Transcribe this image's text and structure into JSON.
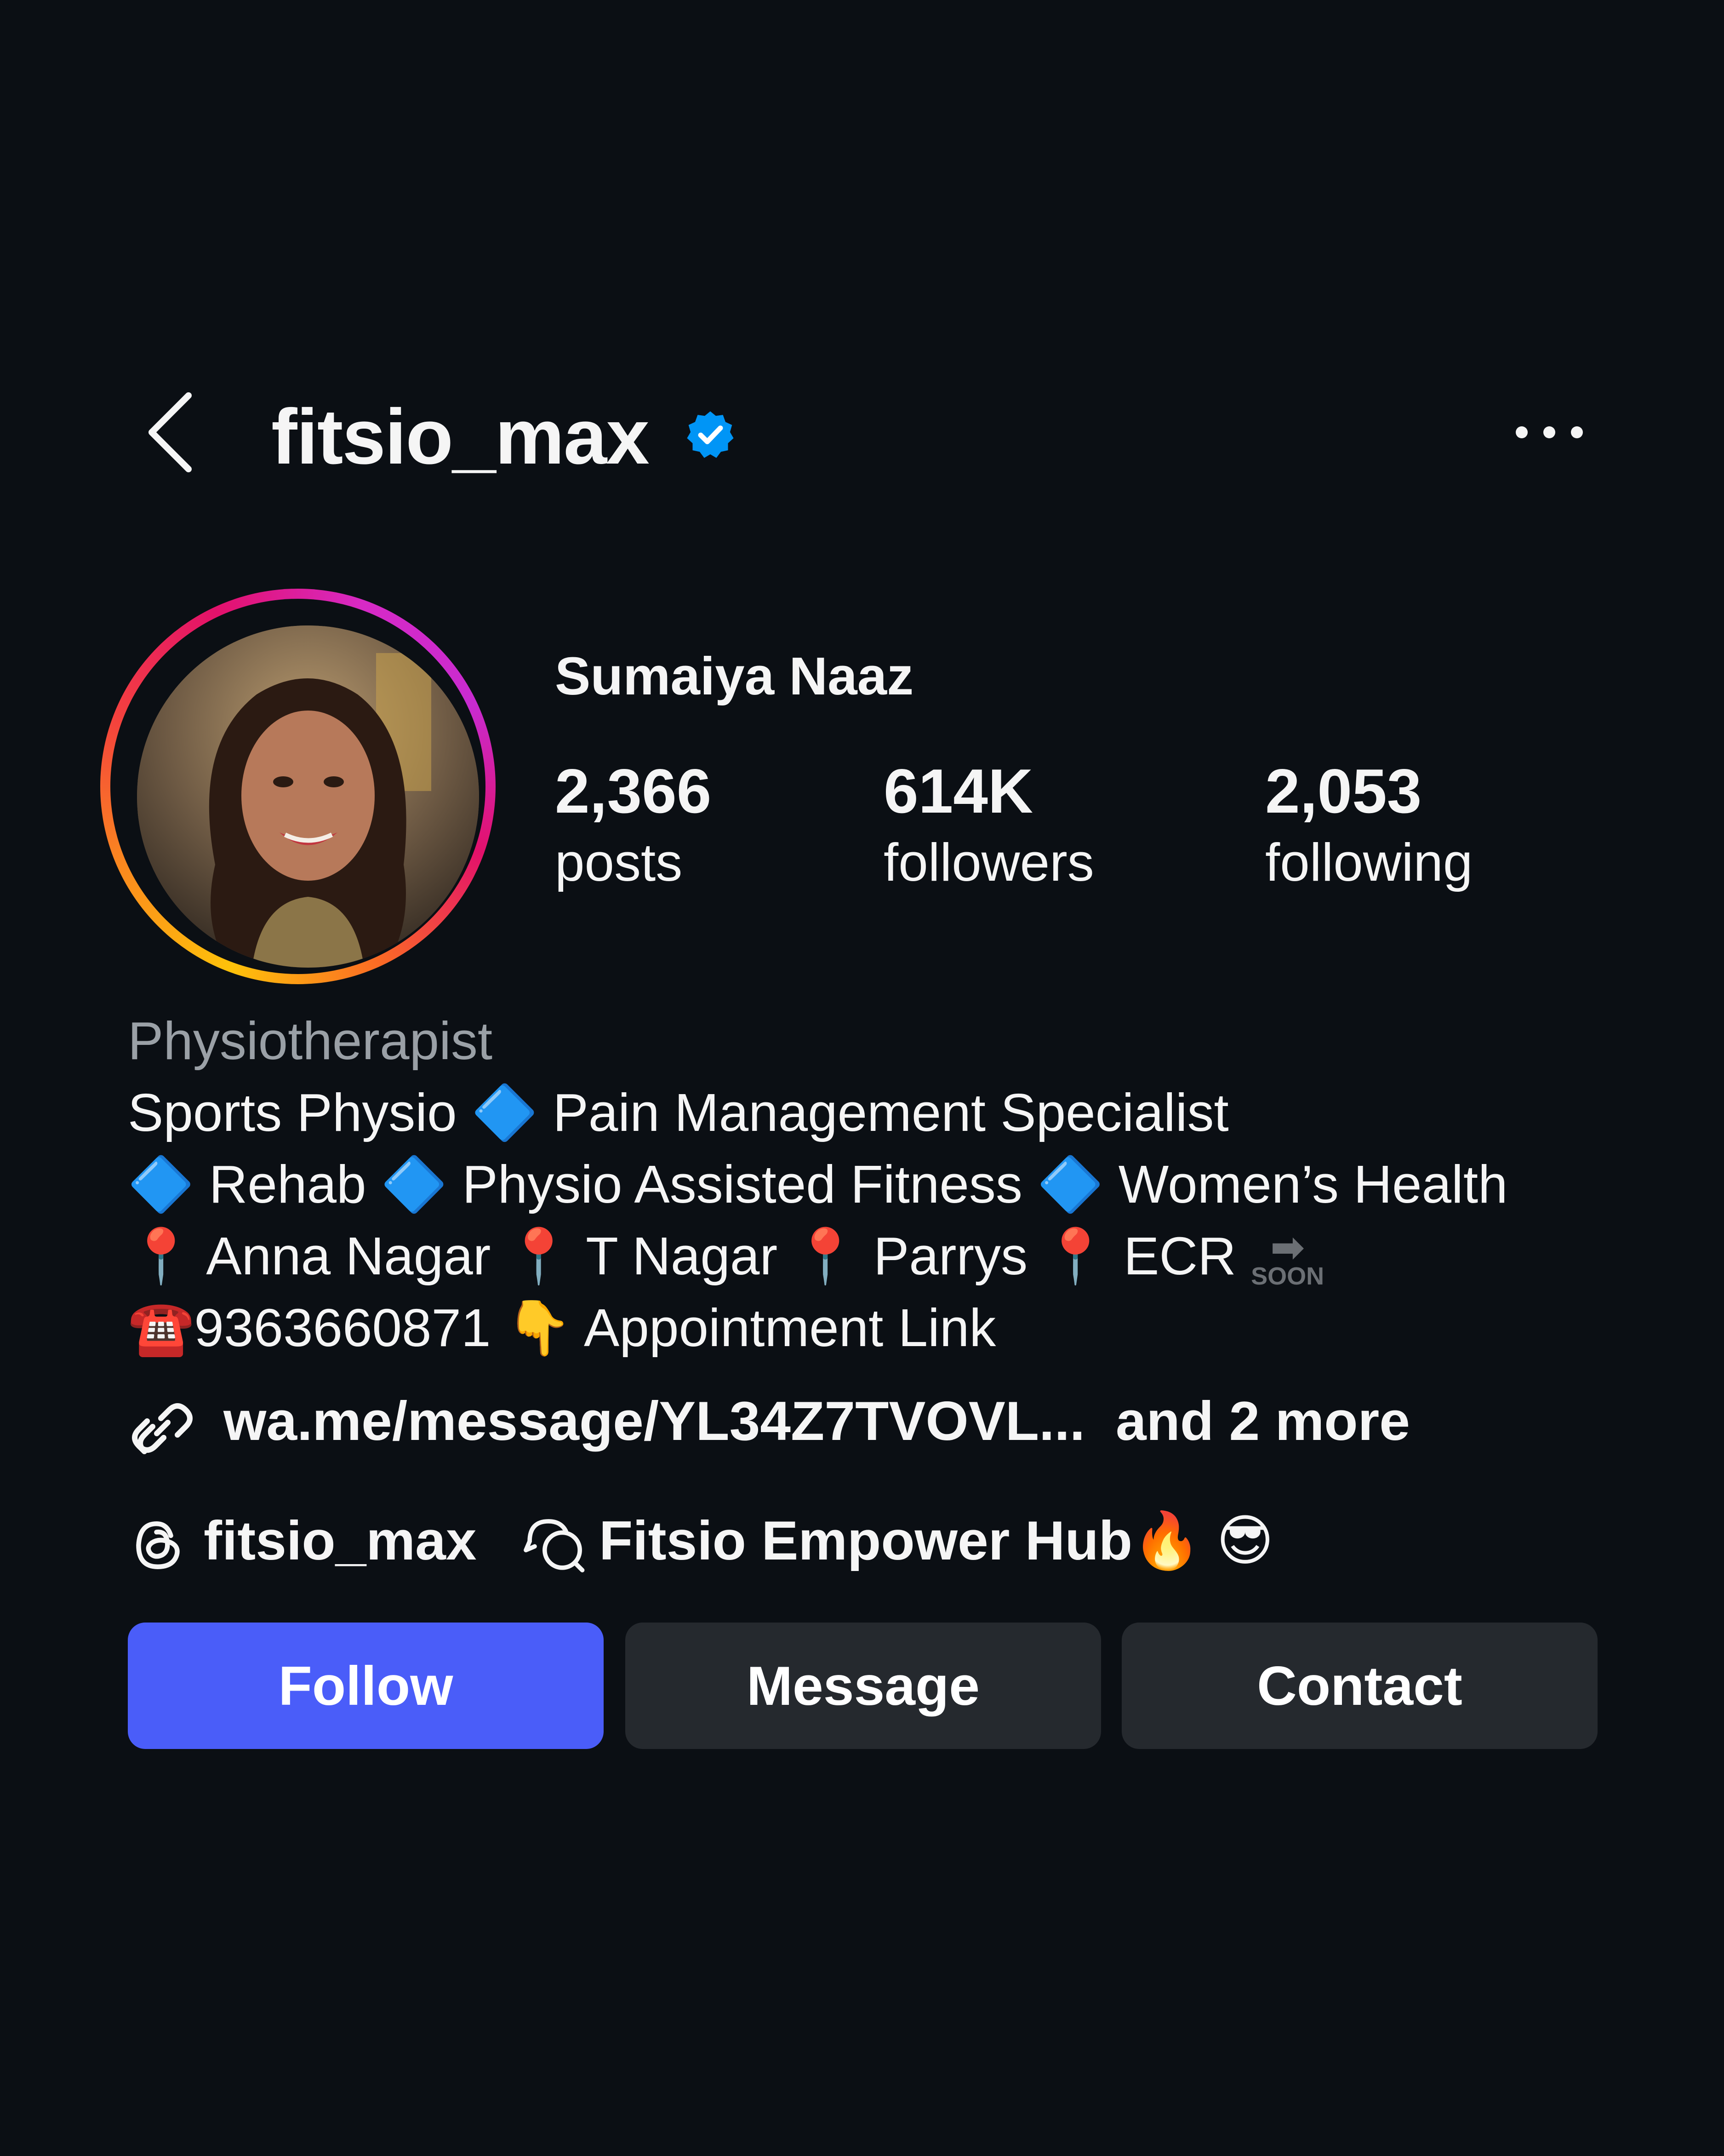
{
  "header": {
    "username": "fitsio_max",
    "verified": true
  },
  "profile": {
    "display_name": "Sumaiya Naaz",
    "avatar": "profile-photo"
  },
  "stats": [
    {
      "value": "2,366",
      "label": "posts"
    },
    {
      "value": "614K",
      "label": "followers"
    },
    {
      "value": "2,053",
      "label": "following"
    }
  ],
  "bio": {
    "category": "Physiotherapist",
    "lines": [
      "Sports Physio 🔷 Pain Management Specialist",
      "🔷 Rehab 🔷 Physio Assisted Fitness 🔷 Women’s Health",
      "📍 Anna Nagar 📍 T Nagar 📍 Parrys 📍 ECR",
      "☎️9363660871  👇 Appointment Link"
    ],
    "soon_badge": "SOON",
    "soon_arrow": "➡"
  },
  "links": {
    "primary": "wa.me/message/YL34Z7TVOVL...",
    "more": "and 2 more"
  },
  "threads": {
    "handle": "fitsio_max"
  },
  "channel": {
    "name": "Fitsio Empower Hub🔥 😎"
  },
  "buttons": {
    "follow": "Follow",
    "message": "Message",
    "contact": "Contact"
  },
  "colors": {
    "background": "#0b0f14",
    "follow_button": "#4a5df9",
    "secondary_button": "#25292e",
    "verified_badge": "#0095f6",
    "category_text": "#9aa0a6"
  }
}
